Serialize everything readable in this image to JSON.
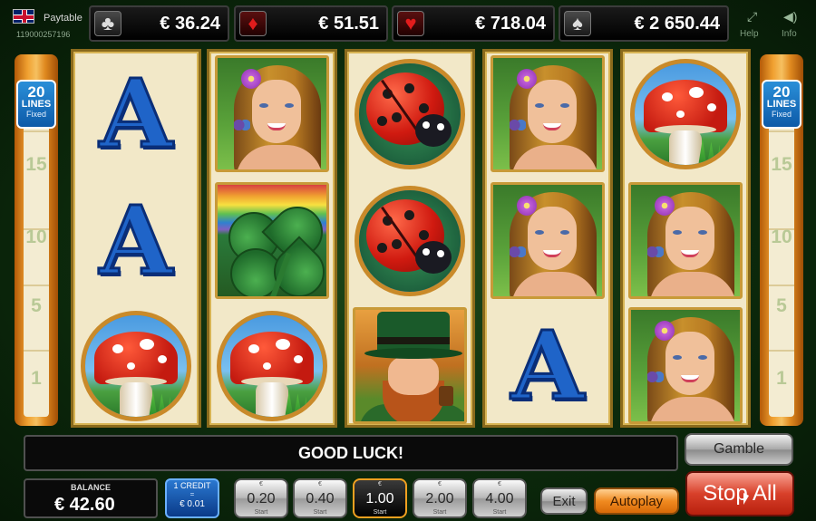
{
  "header": {
    "paytable_label": "Paytable",
    "session_id": "119000257196",
    "help_label": "Help",
    "info_label": "Info",
    "jackpots": [
      {
        "suit": "clubs",
        "symbol": "♣",
        "value": "€ 36.24"
      },
      {
        "suit": "diamonds",
        "symbol": "♦",
        "value": "€ 51.51"
      },
      {
        "suit": "hearts",
        "symbol": "♥",
        "value": "€ 718.04"
      },
      {
        "suit": "spades",
        "symbol": "♠",
        "value": "€ 2 650.44"
      }
    ]
  },
  "lines": {
    "count": "20",
    "word": "LINES",
    "mode": "Fixed",
    "markers": [
      "15",
      "10",
      "5",
      "1"
    ]
  },
  "reels": [
    [
      "ace",
      "ace",
      "mushroom"
    ],
    [
      "fairy",
      "clover",
      "mushroom"
    ],
    [
      "ladybug",
      "ladybug",
      "leprechaun"
    ],
    [
      "fairy",
      "fairy",
      "ace"
    ],
    [
      "mushroom",
      "fairy",
      "fairy"
    ]
  ],
  "symbols": {
    "ace": "A"
  },
  "message": "GOOD LUCK!",
  "gamble_label": "Gamble",
  "balance": {
    "label": "BALANCE",
    "value": "€ 42.60"
  },
  "credit": {
    "top": "1 CREDIT",
    "eq": "=",
    "value": "€ 0.01"
  },
  "bets": [
    {
      "currency": "€",
      "value": "0.20",
      "start": "Start",
      "active": false
    },
    {
      "currency": "€",
      "value": "0.40",
      "start": "Start",
      "active": false
    },
    {
      "currency": "€",
      "value": "1.00",
      "start": "Start",
      "active": true
    },
    {
      "currency": "€",
      "value": "2.00",
      "start": "Start",
      "active": false
    },
    {
      "currency": "€",
      "value": "4.00",
      "start": "Start",
      "active": false
    }
  ],
  "buttons": {
    "exit": "Exit",
    "autoplay": "Autoplay",
    "stop_all": "Stop All"
  },
  "colors": {
    "accent_active_bet": "#f0a020",
    "stop_button": "#d8402a",
    "autoplay_button": "#f08a20",
    "lines_badge": "#1f6fc8"
  }
}
